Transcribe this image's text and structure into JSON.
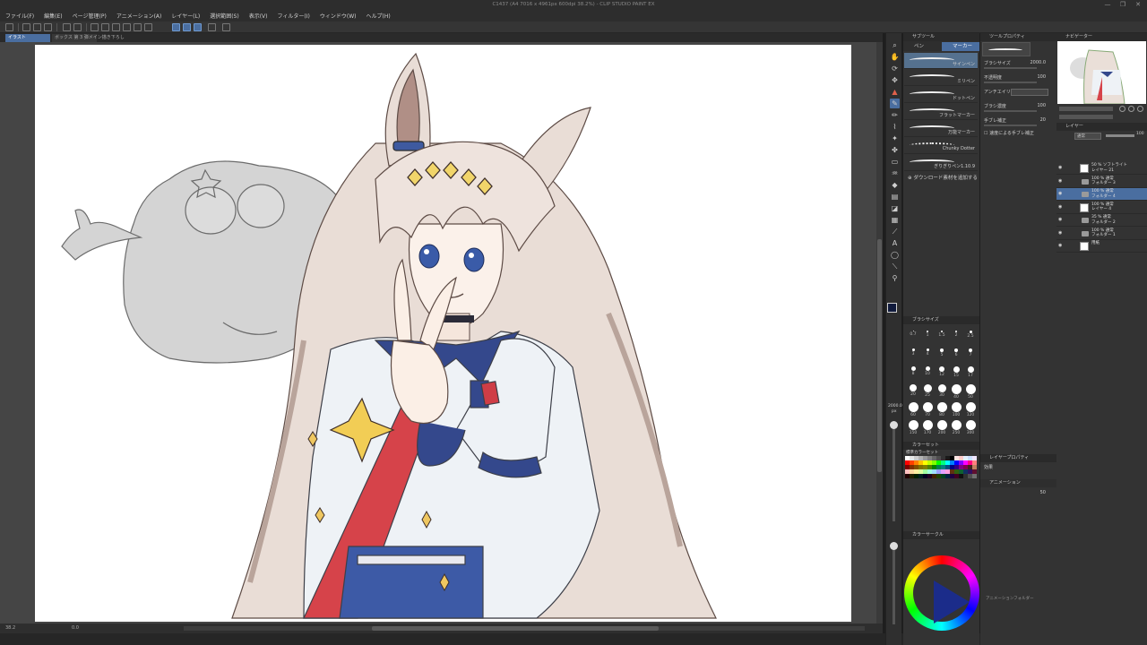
{
  "window": {
    "title": "C1437 (A4 7016 x 4961px 600dpi 38.2%) - CLIP STUDIO PAINT EX",
    "controls": [
      "—",
      "❐",
      "✕"
    ]
  },
  "menu": [
    "ファイル(F)",
    "編集(E)",
    "ページ管理(P)",
    "アニメーション(A)",
    "レイヤー(L)",
    "選択範囲(S)",
    "表示(V)",
    "フィルター(I)",
    "ウィンドウ(W)",
    "ヘルプ(H)"
  ],
  "tabs": [
    {
      "label": "イラスト"
    },
    {
      "label": "ボックス 第 3 弾メイン描き下ろし"
    }
  ],
  "status": {
    "zoom": "38.2",
    "zoom2": "0.0"
  },
  "subtool": {
    "header": "サブツール",
    "tabs": [
      "ペン",
      "マーカー"
    ],
    "brushes": [
      "サインペン",
      "ミリペン",
      "ドットペン",
      "フラットマーカー",
      "万能マーカー",
      "Chunky Dotter",
      "ぎりぎりペン1.10.9"
    ],
    "download": "ダウンロード素材を追加する"
  },
  "toolprop": {
    "header": "ツールプロパティ",
    "size_label": "ブラシサイズ",
    "size_value": "2000.0",
    "opacity_label": "不透明度",
    "opacity_value": "100",
    "aa_label": "アンチエイリアス",
    "density_label": "ブラシ濃度",
    "density_value": "100",
    "stabil_label": "手ブレ補正",
    "stabil_value": "20",
    "speed_label": "速度による手ブレ補正"
  },
  "brushsize": {
    "header": "ブラシサイズ",
    "sizes": [
      "0.7",
      "1",
      "1.5",
      "2",
      "2.5",
      "3",
      "4",
      "5",
      "6",
      "7",
      "8",
      "10",
      "12",
      "15",
      "17",
      "20",
      "25",
      "30",
      "40",
      "50",
      "60",
      "70",
      "80",
      "100",
      "120",
      "150",
      "170",
      "200",
      "250",
      "300"
    ],
    "slider_value": "2000.0",
    "slider_unit": "px"
  },
  "colorset": {
    "header": "カラーセット",
    "set_name": "標準カラーセット",
    "colors": [
      "#ffffff",
      "#e6e6e6",
      "#cccccc",
      "#b3b3b3",
      "#999999",
      "#808080",
      "#666666",
      "#4d4d4d",
      "#333333",
      "#1a1a1a",
      "#000000",
      "#ffe6e6",
      "#ffcccc",
      "#e6f0ff",
      "#cce0ff",
      "#f0e6ff",
      "#ff0000",
      "#ff4000",
      "#ff8000",
      "#ffbf00",
      "#ffff00",
      "#bfff00",
      "#80ff00",
      "#00ff00",
      "#00ff80",
      "#00ffff",
      "#0080ff",
      "#0000ff",
      "#8000ff",
      "#ff00ff",
      "#ff0080",
      "#ff8080",
      "#800000",
      "#803000",
      "#805000",
      "#807000",
      "#808000",
      "#508000",
      "#008000",
      "#008050",
      "#008080",
      "#005080",
      "#000080",
      "#300080",
      "#800080",
      "#800050",
      "#402020",
      "#c08060",
      "#ffc0c0",
      "#ffd8a0",
      "#fff0a0",
      "#e0ffa0",
      "#a0ffa0",
      "#a0ffe0",
      "#a0e0ff",
      "#a0a0ff",
      "#e0a0ff",
      "#ffa0e0",
      "#603010",
      "#306010",
      "#106030",
      "#103060",
      "#301060",
      "#601030",
      "#200000",
      "#202000",
      "#002000",
      "#002020",
      "#000020",
      "#200020",
      "#402000",
      "#204000",
      "#004020",
      "#002040",
      "#200040",
      "#400020",
      "#101010",
      "#303030",
      "#505050",
      "#707070"
    ]
  },
  "colorwheel": {
    "header": "カラーサークル",
    "selected": "#101a3c"
  },
  "layerprop": {
    "header": "レイヤープロパティ",
    "effect_label": "効果",
    "anim_header": "アニメーション",
    "opacity_value": "50",
    "footer": "アニメーションフォルダー"
  },
  "navigator": {
    "header": "ナビゲーター"
  },
  "layers": {
    "header": "レイヤー",
    "blend": "通常",
    "opacity": "100",
    "items": [
      {
        "label": "50 % ソフトライト\nレイヤー 21",
        "type": "layer",
        "selected": false
      },
      {
        "label": "100 % 通常\nフォルダー 3",
        "type": "folder",
        "selected": false
      },
      {
        "label": "100 % 通常\nフォルダー 4",
        "type": "folder",
        "selected": true
      },
      {
        "label": "100 % 通常\nレイヤー 4",
        "type": "layer",
        "selected": false
      },
      {
        "label": "35 % 通常\nフォルダー 2",
        "type": "folder",
        "selected": false
      },
      {
        "label": "100 % 通常\nフォルダー 1",
        "type": "folder",
        "selected": false
      },
      {
        "label": "用紙",
        "type": "paper",
        "selected": false
      }
    ]
  }
}
